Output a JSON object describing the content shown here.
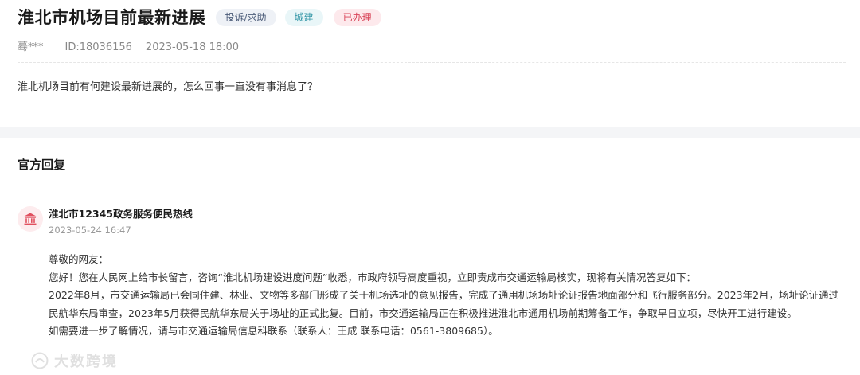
{
  "post": {
    "title": "淮北市机场目前最新进展",
    "tags": {
      "type": "投诉/求助",
      "category": "城建",
      "status": "已办理"
    },
    "author": "蓦***",
    "id": "ID:18036156",
    "datetime": "2023-05-18 18:00",
    "content": "淮北机场目前有何建设最新进展的，怎么回事一直没有事消息了？"
  },
  "reply_section": {
    "heading": "官方回复",
    "organization": "淮北市12345政务服务便民热线",
    "datetime": "2023-05-24 16:47",
    "paragraphs": [
      "尊敬的网友：",
      "您好！您在人民网上给市长留言，咨询“淮北机场建设进度问题”收悉，市政府领导高度重视，立即责成市交通运输局核实，现将有关情况答复如下：",
      "2022年8月，市交通运输局已会同住建、林业、文物等多部门形成了关于机场选址的意见报告，完成了通用机场场址论证报告地面部分和飞行服务部分。2023年2月，场址论证通过民航华东局审查，2023年5月获得民航华东局关于场址的正式批复。目前，市交通运输局正在积极推进淮北市通用机场前期筹备工作，争取早日立项，尽快开工进行建设。",
      "如需要进一步了解情况，请与市交通运输局信息科联系（联系人：王成  联系电话：0561-3809685）。"
    ]
  },
  "watermark": {
    "text": "大数跨境"
  },
  "colors": {
    "status_red": "#d9465a",
    "category_teal": "#3a9aaa",
    "avatar_red": "#e0505f"
  },
  "icons": {
    "avatar": "government-building-icon",
    "watermark": "watermark-logo-icon"
  }
}
